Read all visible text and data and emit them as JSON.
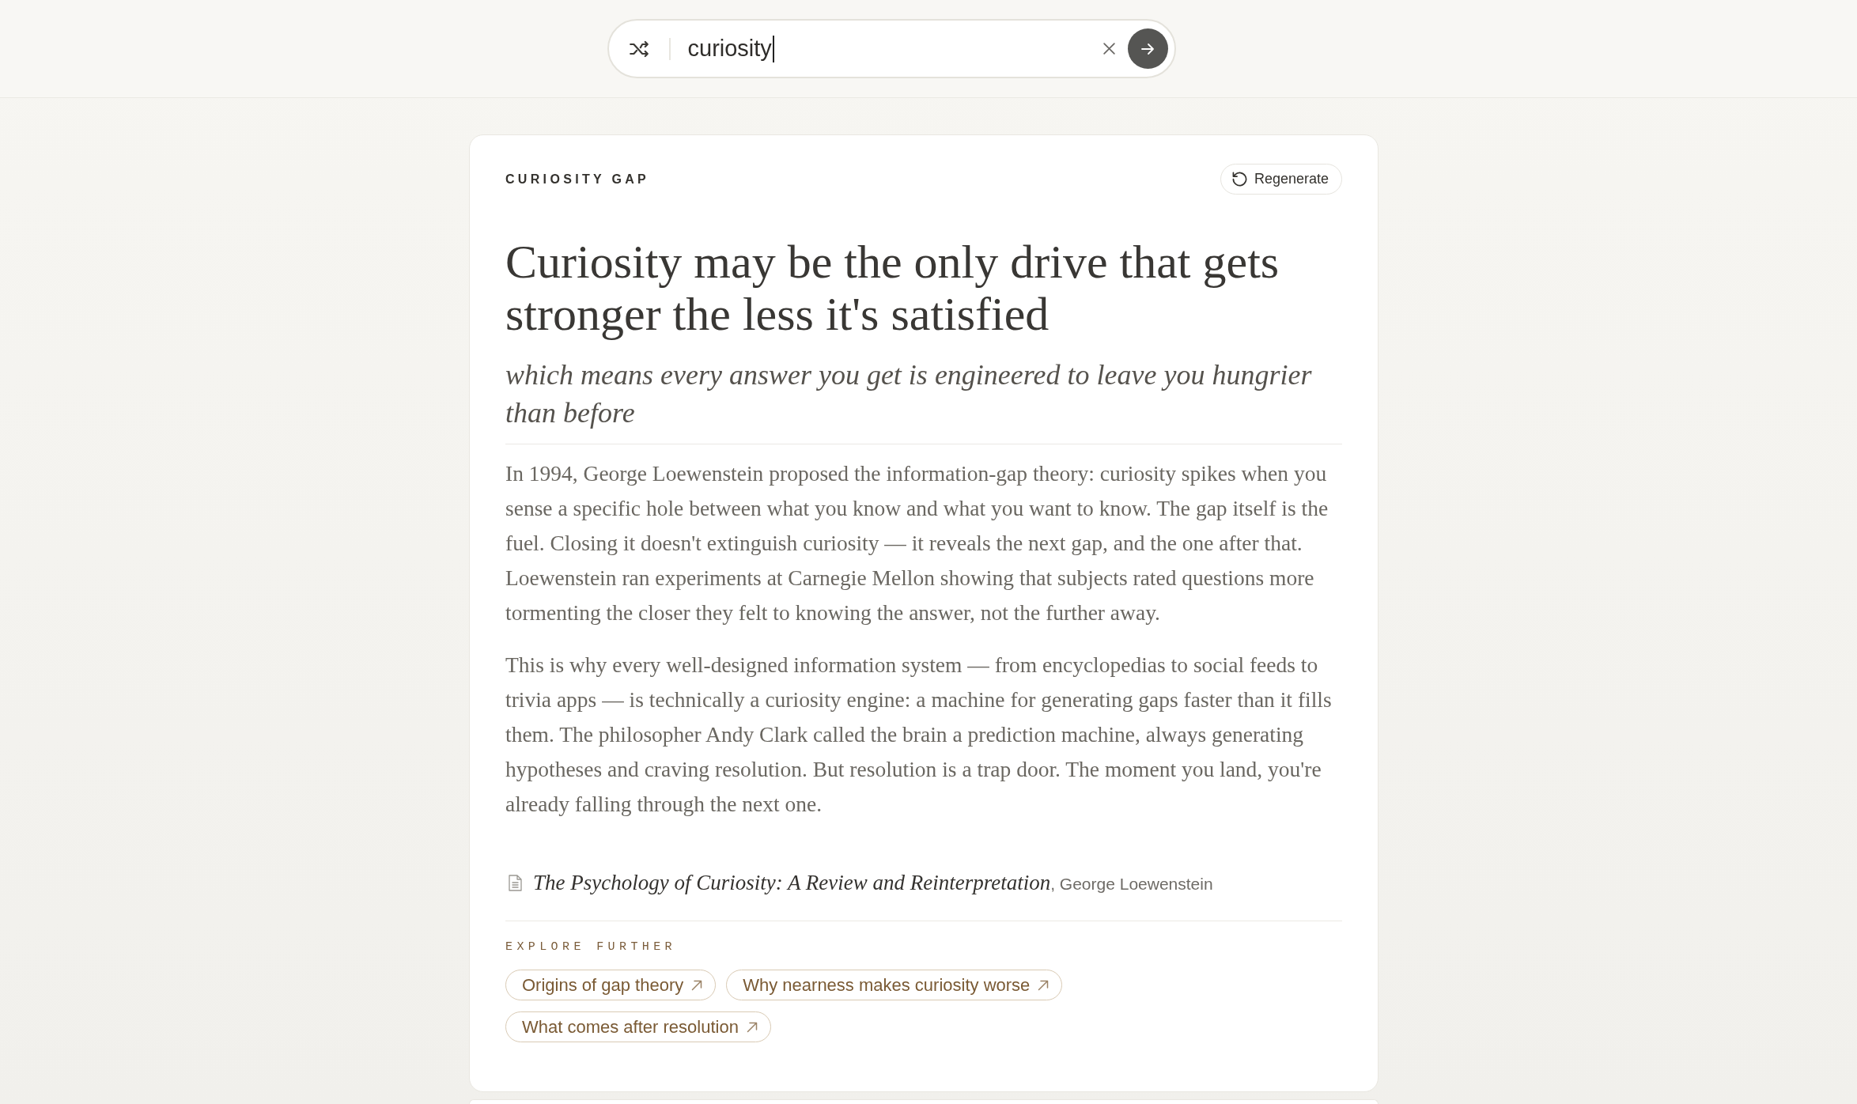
{
  "search": {
    "value": "curiosity"
  },
  "card": {
    "eyebrow": "CURIOSITY GAP",
    "regenerate_label": "Regenerate",
    "headline": "Curiosity may be the only drive that gets stronger the less it's satisfied",
    "subheadline": "which means every answer you get is engineered to leave you hungrier than before",
    "paragraphs": [
      "In 1994, George Loewenstein proposed the information-gap theory: curiosity spikes when you sense a specific hole between what you know and what you want to know. The gap itself is the fuel. Closing it doesn't extinguish curiosity — it reveals the next gap, and the one after that. Loewenstein ran experiments at Carnegie Mellon showing that subjects rated questions more tormenting the closer they felt to knowing the answer, not the further away.",
      "This is why every well-designed information system — from encyclopedias to social feeds to trivia apps — is technically a curiosity engine: a machine for generating gaps faster than it fills them. The philosopher Andy Clark called the brain a prediction machine, always generating hypotheses and craving resolution. But resolution is a trap door. The moment you land, you're already falling through the next one."
    ],
    "citation": "*The Psychology of Curiosity: A Review and Reinterpretation*, George Loewenstein",
    "explore": {
      "heading": "EXPLORE FURTHER",
      "links": [
        "Origins of gap theory",
        "Why nearness makes curiosity worse",
        "What comes after resolution"
      ]
    }
  }
}
